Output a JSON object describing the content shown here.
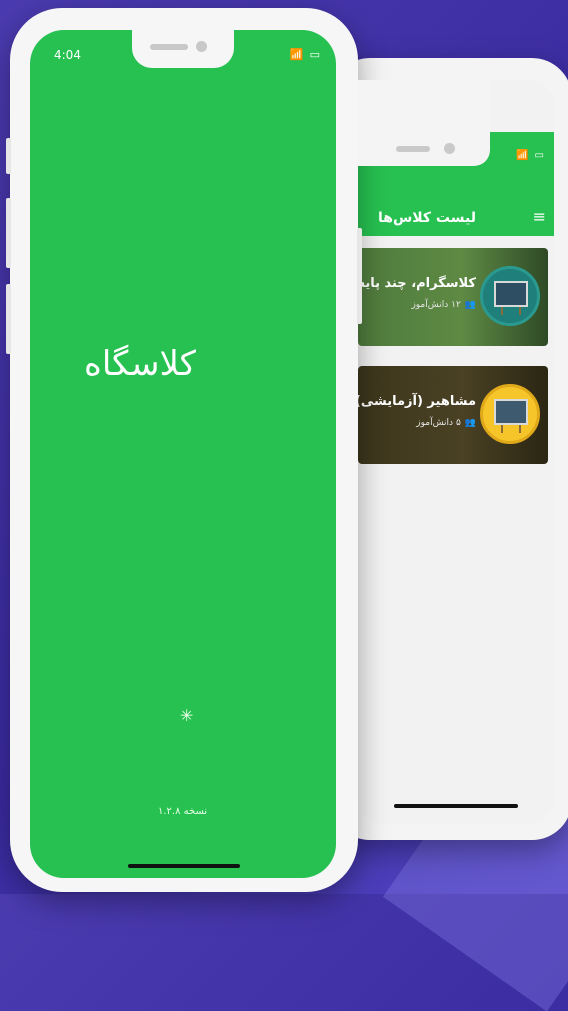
{
  "class_list_app": {
    "status": {
      "icons": [
        "wifi-icon",
        "battery-icon"
      ]
    },
    "header": {
      "title": "لیست کلاس‌ها",
      "menu_icon": "menu-icon"
    },
    "classes": [
      {
        "name": "کلاسگرام، چند پایه",
        "students": "۱۲ دانش‌آموز"
      },
      {
        "name": "مشاهیر (آزمایشی)",
        "students": "۵ دانش‌آموز"
      }
    ]
  },
  "splash_app": {
    "status": {
      "time": "4:04",
      "icons": [
        "wifi-icon",
        "battery-icon"
      ]
    },
    "logo_text": "کلاسگاه",
    "version_text": "نسخه ۱.۲.۸"
  },
  "colors": {
    "brand_green": "#27c151",
    "background": "#4b3bb0"
  }
}
